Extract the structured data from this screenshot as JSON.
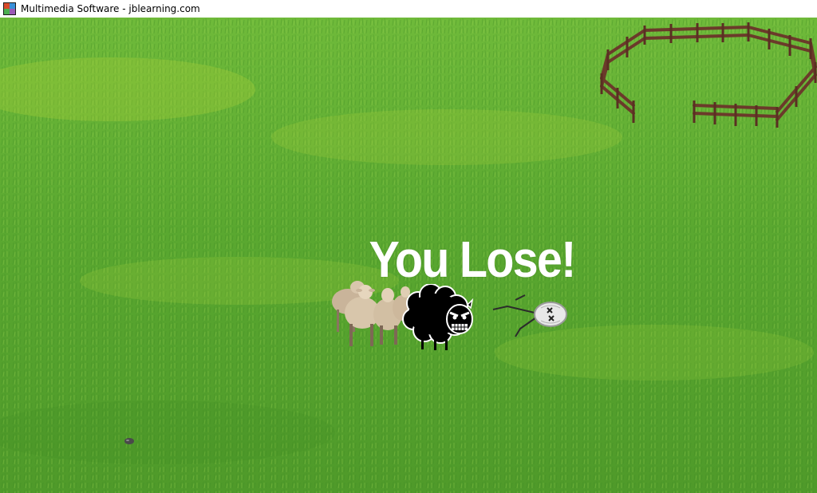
{
  "window": {
    "title": "Multimedia Software - jblearning.com",
    "icon": "multimedia-app-icon"
  },
  "game": {
    "message": "You Lose!",
    "background": "grass-field",
    "colors": {
      "grass": "#5aa830",
      "grass_light": "#8cc63f",
      "fence": "#6b3a2a",
      "message": "#ffffff",
      "black_sheep": "#000000"
    },
    "sprites": {
      "flock": "white-sheep-flock",
      "player": "angry-black-sheep",
      "enemy": "defeated-wolf-bug",
      "pen": "wooden-fence-pen",
      "debris": "small-stone"
    }
  }
}
